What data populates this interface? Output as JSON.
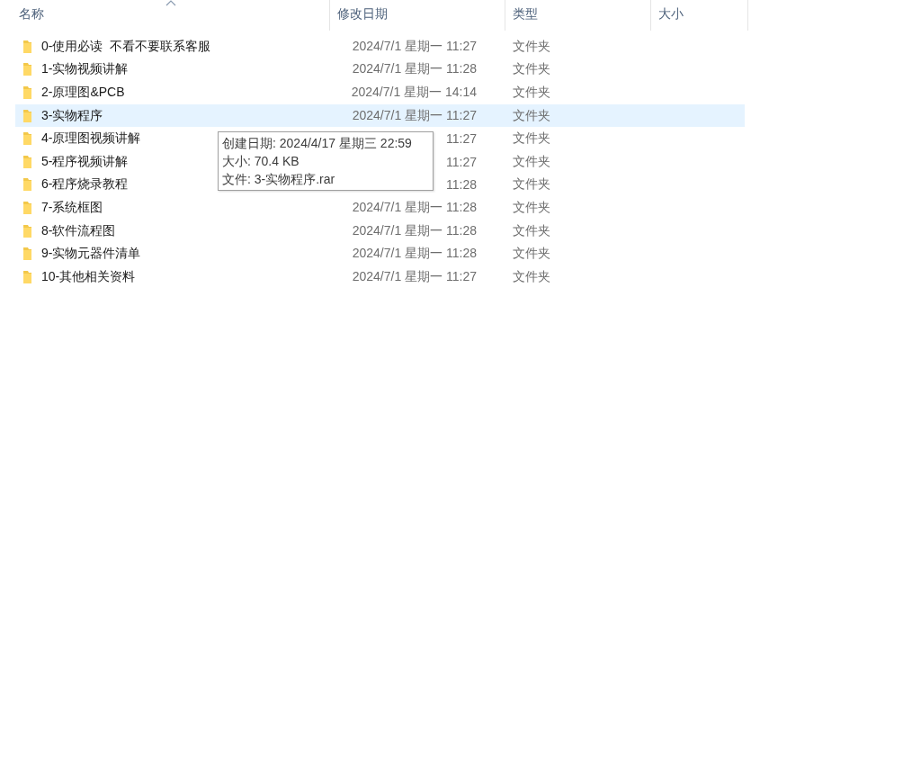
{
  "columns": [
    {
      "label": "名称",
      "sorted": true
    },
    {
      "label": "修改日期",
      "sorted": false
    },
    {
      "label": "类型",
      "sorted": false
    },
    {
      "label": "大小",
      "sorted": false
    }
  ],
  "rows": [
    {
      "name": "0-使用必读  不看不要联系客服",
      "date": "2024/7/1 星期一 11:27",
      "type": "文件夹",
      "selected": false
    },
    {
      "name": "1-实物视频讲解",
      "date": "2024/7/1 星期一 11:28",
      "type": "文件夹",
      "selected": false
    },
    {
      "name": "2-原理图&PCB",
      "date": "2024/7/1 星期一 14:14",
      "type": "文件夹",
      "selected": false
    },
    {
      "name": "3-实物程序",
      "date": "2024/7/1 星期一 11:27",
      "type": "文件夹",
      "selected": true
    },
    {
      "name": "4-原理图视频讲解",
      "date": "11:27",
      "type": "文件夹",
      "selected": false
    },
    {
      "name": "5-程序视频讲解",
      "date": "11:27",
      "type": "文件夹",
      "selected": false
    },
    {
      "name": "6-程序烧录教程",
      "date": "11:28",
      "type": "文件夹",
      "selected": false
    },
    {
      "name": "7-系统框图",
      "date": "2024/7/1 星期一 11:28",
      "type": "文件夹",
      "selected": false
    },
    {
      "name": "8-软件流程图",
      "date": "2024/7/1 星期一 11:28",
      "type": "文件夹",
      "selected": false
    },
    {
      "name": "9-实物元器件清单",
      "date": "2024/7/1 星期一 11:28",
      "type": "文件夹",
      "selected": false
    },
    {
      "name": "10-其他相关资料",
      "date": "2024/7/1 星期一 11:27",
      "type": "文件夹",
      "selected": false
    }
  ],
  "tooltip": {
    "lines": [
      "创建日期: 2024/4/17 星期三 22:59",
      "大小: 70.4 KB",
      "文件: 3-实物程序.rar"
    ]
  }
}
